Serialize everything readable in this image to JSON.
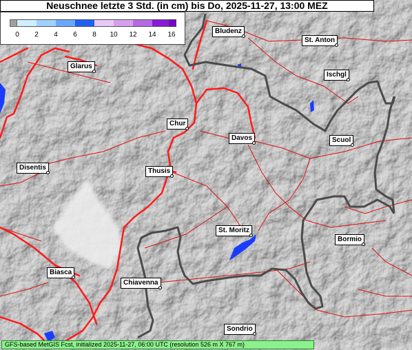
{
  "title": "Neuschnee letzte 3 Std. (in cm) bis Do, 2025-11-27, 13:00 MEZ",
  "legend": {
    "ticks": [
      "0",
      "2",
      "4",
      "6",
      "8",
      "10",
      "12",
      "14",
      "16"
    ],
    "colors": [
      "#cfefff",
      "#9fd0ff",
      "#6aa8ff",
      "#2060f0",
      "#e8c8f4",
      "#d4a0ee",
      "#b46ae4",
      "#8a1ad8"
    ],
    "nodata_color": "#a0a0a0",
    "overflow_color": "#7a00d0"
  },
  "places": [
    {
      "name": "Bludenz"
    },
    {
      "name": "St. Anton"
    },
    {
      "name": "Glarus"
    },
    {
      "name": "Ischgl"
    },
    {
      "name": "Chur"
    },
    {
      "name": "Davos"
    },
    {
      "name": "Scuol"
    },
    {
      "name": "Disentis"
    },
    {
      "name": "Thusis"
    },
    {
      "name": "St. Moritz"
    },
    {
      "name": "Bormio"
    },
    {
      "name": "Biasca"
    },
    {
      "name": "Chiavenna"
    },
    {
      "name": "Sondrio"
    }
  ],
  "footer": "GFS-based MetGIS Fcst, initialized 2025-11-27, 06:00 UTC  (resolution 526 m X 767 m)",
  "colors": {
    "roads": "#ff1a1a",
    "border": "#4a4a4a",
    "lakes": "#1a3cff",
    "footer_bg": "#8cf08c"
  }
}
